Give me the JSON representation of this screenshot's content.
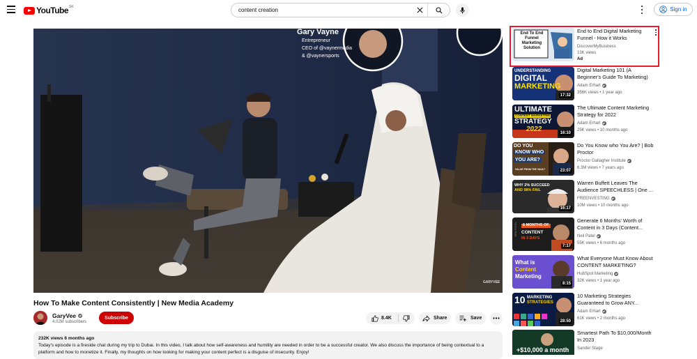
{
  "header": {
    "logo_text": "YouTube",
    "logo_country": "SK",
    "search_value": "content creation",
    "signin_label": "Sign in"
  },
  "video": {
    "title": "How To Make Content Consistently | New Media Academy",
    "overlay_name": "Gary Vayne",
    "overlay_roles": [
      "Entrepreneur",
      "CEO of @vaynermedia",
      "& @vaynersports"
    ],
    "watermark": "GARYVEE",
    "channel": "GaryVee",
    "subscribers": "4.02M subscribers",
    "subscribe_label": "Subscribe",
    "likes": "8.4K",
    "share_label": "Share",
    "save_label": "Save",
    "views_time": "232K views  6 months ago",
    "description": "Today's episode is a fireside chat during my trip to Dubai. In this video, I talk about how self-awareness and humility are needed in order to be a successful creator. We also discuss the importance of being contextual to a platform and how to monetize it. Finally, my thoughts on how looking for making your content perfect is a disguise of insecurity. Enjoy!"
  },
  "ad": {
    "title": "End to End Digital Marketing Funnel - How it Works",
    "channel": "DiscoverMyBusiness",
    "views": "13K views",
    "label": "Ad",
    "thumb_text": "End To End Funnel Marketing Solution"
  },
  "recommendations": [
    {
      "title": "Digital Marketing 101 (A Beginner's Guide To Marketing)",
      "channel": "Adam Erhart",
      "meta": "356K views • 1 year ago",
      "duration": "17:32",
      "thumb_lines": [
        "UNDERSTANDING",
        "DIGITAL",
        "MARKETING"
      ]
    },
    {
      "title": "The Ultimate Content Marketing Strategy for 2022",
      "channel": "Adam Erhart",
      "meta": "25K views • 10 months ago",
      "duration": "16:10",
      "thumb_lines": [
        "ULTIMATE",
        "CONTENT MARKETING",
        "STRATEGY",
        "2022"
      ]
    },
    {
      "title": "Do You Know who You Are? | Bob Proctor",
      "channel": "Proctor Gallagher Institute",
      "meta": "6.3M views • 7 years ago",
      "duration": "23:07",
      "thumb_lines": [
        "DO YOU",
        "KNOW WHO",
        "YOU ARE?",
        "VALUE FROM THE VAULT"
      ]
    },
    {
      "title": "Warren Buffett Leaves The Audience SPEECHLESS | One ...",
      "channel": "FREENVESTING",
      "meta": "10M views • 10 months ago",
      "duration": "16:17",
      "thumb_lines": [
        "WHY 2% SUCCEED",
        "AND 98% FAIL"
      ]
    },
    {
      "title": "Generate 6 Months' Worth of Content in 3 Days (Content...",
      "channel": "Neil Patel",
      "meta": "55K views • 6 months ago",
      "duration": "7:17",
      "thumb_lines": [
        "6 MONTHS OF",
        "CONTENT",
        "IN 3 DAYS",
        "NEILPATEL"
      ]
    },
    {
      "title": "What Everyone Must Know About CONTENT MARKETING?",
      "channel": "HubSpot Marketing",
      "meta": "32K views • 1 year ago",
      "duration": "8:15",
      "thumb_lines": [
        "What is",
        "Content",
        "Marketing"
      ]
    },
    {
      "title": "10 Marketing Strategies Guaranteed to Grow ANY...",
      "channel": "Adam Erhart",
      "meta": "61K views • 2 months ago",
      "duration": "28:50",
      "thumb_lines": [
        "10",
        "MARKETING",
        "STRATEGIES"
      ]
    },
    {
      "title": "Smartest Path To $10,000/Month In 2023",
      "channel": "Sander Stage",
      "meta": "",
      "duration": "",
      "thumb_lines": [
        "+$10,000 a month"
      ]
    }
  ],
  "colors": {
    "brand_red": "#ff0000",
    "subscribe_red": "#cc0000",
    "link_blue": "#065fd4",
    "highlight_border": "#e8192c"
  }
}
